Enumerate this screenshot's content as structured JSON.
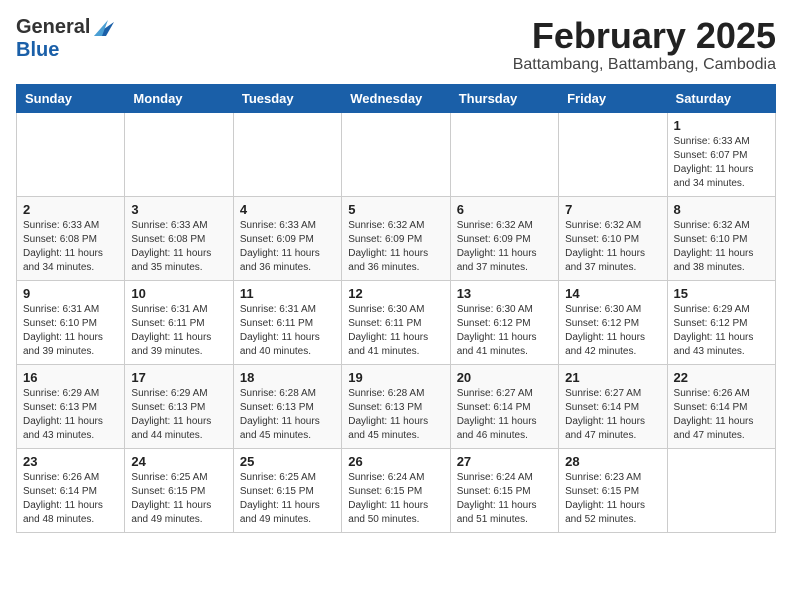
{
  "header": {
    "logo_general": "General",
    "logo_blue": "Blue",
    "month_title": "February 2025",
    "location": "Battambang, Battambang, Cambodia"
  },
  "weekdays": [
    "Sunday",
    "Monday",
    "Tuesday",
    "Wednesday",
    "Thursday",
    "Friday",
    "Saturday"
  ],
  "weeks": [
    [
      {
        "day": "",
        "info": ""
      },
      {
        "day": "",
        "info": ""
      },
      {
        "day": "",
        "info": ""
      },
      {
        "day": "",
        "info": ""
      },
      {
        "day": "",
        "info": ""
      },
      {
        "day": "",
        "info": ""
      },
      {
        "day": "1",
        "info": "Sunrise: 6:33 AM\nSunset: 6:07 PM\nDaylight: 11 hours\nand 34 minutes."
      }
    ],
    [
      {
        "day": "2",
        "info": "Sunrise: 6:33 AM\nSunset: 6:08 PM\nDaylight: 11 hours\nand 34 minutes."
      },
      {
        "day": "3",
        "info": "Sunrise: 6:33 AM\nSunset: 6:08 PM\nDaylight: 11 hours\nand 35 minutes."
      },
      {
        "day": "4",
        "info": "Sunrise: 6:33 AM\nSunset: 6:09 PM\nDaylight: 11 hours\nand 36 minutes."
      },
      {
        "day": "5",
        "info": "Sunrise: 6:32 AM\nSunset: 6:09 PM\nDaylight: 11 hours\nand 36 minutes."
      },
      {
        "day": "6",
        "info": "Sunrise: 6:32 AM\nSunset: 6:09 PM\nDaylight: 11 hours\nand 37 minutes."
      },
      {
        "day": "7",
        "info": "Sunrise: 6:32 AM\nSunset: 6:10 PM\nDaylight: 11 hours\nand 37 minutes."
      },
      {
        "day": "8",
        "info": "Sunrise: 6:32 AM\nSunset: 6:10 PM\nDaylight: 11 hours\nand 38 minutes."
      }
    ],
    [
      {
        "day": "9",
        "info": "Sunrise: 6:31 AM\nSunset: 6:10 PM\nDaylight: 11 hours\nand 39 minutes."
      },
      {
        "day": "10",
        "info": "Sunrise: 6:31 AM\nSunset: 6:11 PM\nDaylight: 11 hours\nand 39 minutes."
      },
      {
        "day": "11",
        "info": "Sunrise: 6:31 AM\nSunset: 6:11 PM\nDaylight: 11 hours\nand 40 minutes."
      },
      {
        "day": "12",
        "info": "Sunrise: 6:30 AM\nSunset: 6:11 PM\nDaylight: 11 hours\nand 41 minutes."
      },
      {
        "day": "13",
        "info": "Sunrise: 6:30 AM\nSunset: 6:12 PM\nDaylight: 11 hours\nand 41 minutes."
      },
      {
        "day": "14",
        "info": "Sunrise: 6:30 AM\nSunset: 6:12 PM\nDaylight: 11 hours\nand 42 minutes."
      },
      {
        "day": "15",
        "info": "Sunrise: 6:29 AM\nSunset: 6:12 PM\nDaylight: 11 hours\nand 43 minutes."
      }
    ],
    [
      {
        "day": "16",
        "info": "Sunrise: 6:29 AM\nSunset: 6:13 PM\nDaylight: 11 hours\nand 43 minutes."
      },
      {
        "day": "17",
        "info": "Sunrise: 6:29 AM\nSunset: 6:13 PM\nDaylight: 11 hours\nand 44 minutes."
      },
      {
        "day": "18",
        "info": "Sunrise: 6:28 AM\nSunset: 6:13 PM\nDaylight: 11 hours\nand 45 minutes."
      },
      {
        "day": "19",
        "info": "Sunrise: 6:28 AM\nSunset: 6:13 PM\nDaylight: 11 hours\nand 45 minutes."
      },
      {
        "day": "20",
        "info": "Sunrise: 6:27 AM\nSunset: 6:14 PM\nDaylight: 11 hours\nand 46 minutes."
      },
      {
        "day": "21",
        "info": "Sunrise: 6:27 AM\nSunset: 6:14 PM\nDaylight: 11 hours\nand 47 minutes."
      },
      {
        "day": "22",
        "info": "Sunrise: 6:26 AM\nSunset: 6:14 PM\nDaylight: 11 hours\nand 47 minutes."
      }
    ],
    [
      {
        "day": "23",
        "info": "Sunrise: 6:26 AM\nSunset: 6:14 PM\nDaylight: 11 hours\nand 48 minutes."
      },
      {
        "day": "24",
        "info": "Sunrise: 6:25 AM\nSunset: 6:15 PM\nDaylight: 11 hours\nand 49 minutes."
      },
      {
        "day": "25",
        "info": "Sunrise: 6:25 AM\nSunset: 6:15 PM\nDaylight: 11 hours\nand 49 minutes."
      },
      {
        "day": "26",
        "info": "Sunrise: 6:24 AM\nSunset: 6:15 PM\nDaylight: 11 hours\nand 50 minutes."
      },
      {
        "day": "27",
        "info": "Sunrise: 6:24 AM\nSunset: 6:15 PM\nDaylight: 11 hours\nand 51 minutes."
      },
      {
        "day": "28",
        "info": "Sunrise: 6:23 AM\nSunset: 6:15 PM\nDaylight: 11 hours\nand 52 minutes."
      },
      {
        "day": "",
        "info": ""
      }
    ]
  ]
}
